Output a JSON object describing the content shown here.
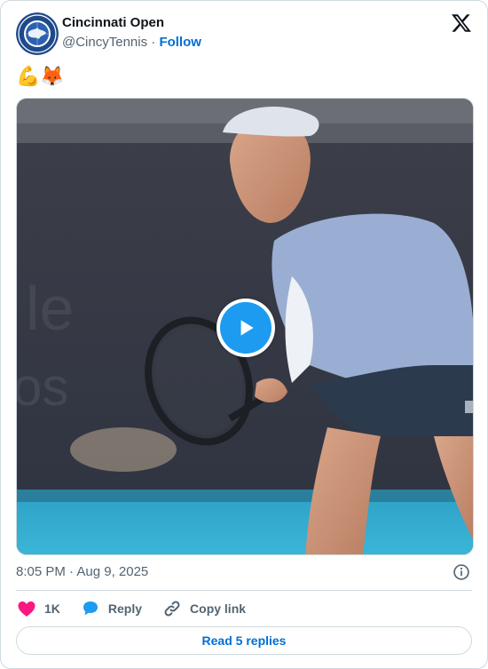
{
  "author": {
    "display_name": "Cincinnati Open",
    "handle": "@CincyTennis",
    "separator": "·",
    "follow_label": "Follow"
  },
  "tweet": {
    "text": "💪🦊"
  },
  "media": {
    "type": "video",
    "play_icon": "play-icon"
  },
  "meta": {
    "timestamp": "8:05 PM · Aug 9, 2025",
    "info_icon": "info-icon"
  },
  "actions": {
    "like_count": "1K",
    "reply_label": "Reply",
    "copy_label": "Copy link"
  },
  "footer": {
    "read_replies_label": "Read 5 replies"
  },
  "colors": {
    "accent": "#1d9bf0",
    "link": "#006fd6",
    "like": "#f91880",
    "muted": "#536471",
    "border": "#cfd9de"
  }
}
